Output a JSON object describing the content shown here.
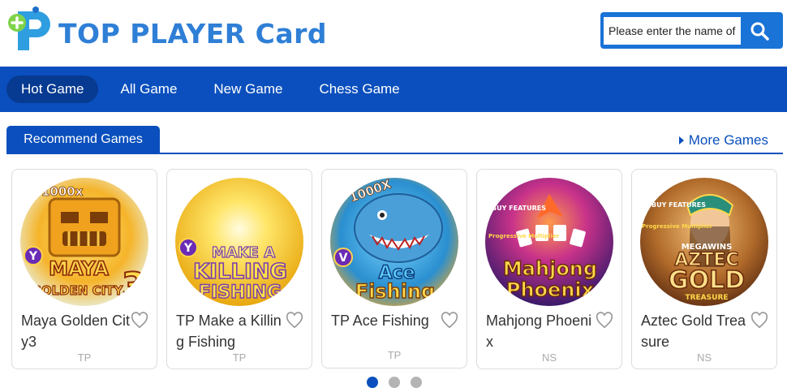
{
  "brand": {
    "name": "TOP PLAYER Card"
  },
  "search": {
    "placeholder": "Please enter the name of the game",
    "icon": "search-icon"
  },
  "nav": {
    "items": [
      {
        "label": "Hot Game",
        "active": true
      },
      {
        "label": "All Game",
        "active": false
      },
      {
        "label": "New Game",
        "active": false
      },
      {
        "label": "Chess Game",
        "active": false
      }
    ]
  },
  "section": {
    "title": "Recommend Games",
    "more_label": "More Games"
  },
  "games": [
    {
      "title": "Maya Golden City3",
      "vendor": "TP",
      "art_text": [
        "MAYA",
        "GOLDEN CITY",
        "1000x",
        "3"
      ]
    },
    {
      "title": "TP Make a Killing Fishing",
      "vendor": "TP",
      "art_text": [
        "MAKE A",
        "KILLING",
        "FISHING"
      ]
    },
    {
      "title": "TP Ace Fishing",
      "vendor": "TP",
      "art_text": [
        "1000X",
        "Ace",
        "Fishing"
      ]
    },
    {
      "title": "Mahjong Phoenix",
      "vendor": "NS",
      "art_text": [
        "BUY FEATURES",
        "Progressive Multiplier",
        "Mahjong",
        "Phoenix"
      ]
    },
    {
      "title": "Aztec Gold Treasure",
      "vendor": "NS",
      "art_text": [
        "BUY FEATURES",
        "Progressive Multiplier",
        "MEGAWINS",
        "AZTEC",
        "GOLD",
        "TREASURE"
      ]
    }
  ],
  "carousel": {
    "pages": 3,
    "active": 0
  },
  "colors": {
    "primary": "#0a4fbd",
    "accent": "#1a73d6",
    "logo": "#2f7fd6"
  }
}
